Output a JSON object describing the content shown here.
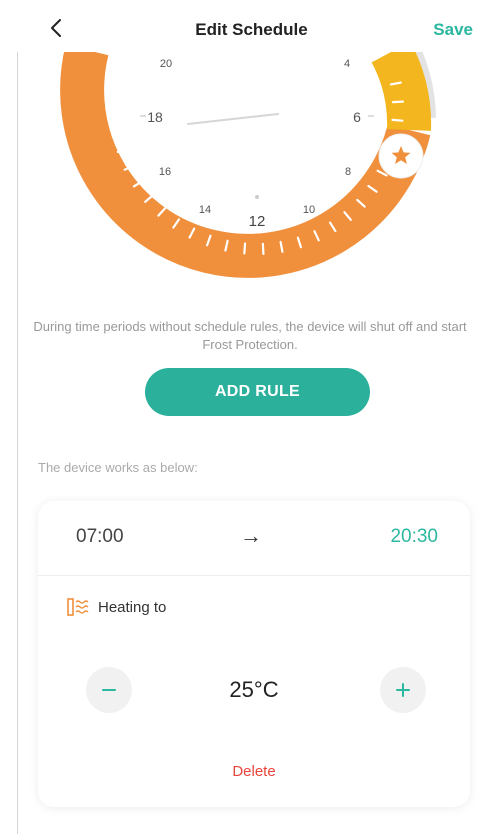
{
  "header": {
    "title": "Edit Schedule",
    "save_label": "Save",
    "back_icon": "chevron-left-icon"
  },
  "dial": {
    "hour_labels": [
      "20",
      "18",
      "16",
      "14",
      "12",
      "10",
      "8",
      "6",
      "4"
    ],
    "ring_color": "#f08f3c",
    "highlight_color": "#f3b61f",
    "star_icon": "star-icon"
  },
  "notice": "During time periods without schedule rules, the device will shut off and start Frost Protection.",
  "add_rule_label": "ADD RULE",
  "works_label": "The device works as below:",
  "rule": {
    "start_time": "07:00",
    "arrow": "→",
    "end_time": "20:30",
    "mode_label": "Heating to",
    "mode_icon": "heating-icon",
    "temperature": "25°C",
    "delete_label": "Delete"
  },
  "colors": {
    "accent": "#2bb7a0",
    "danger": "#e8453c",
    "heating": "#f08f3c"
  }
}
